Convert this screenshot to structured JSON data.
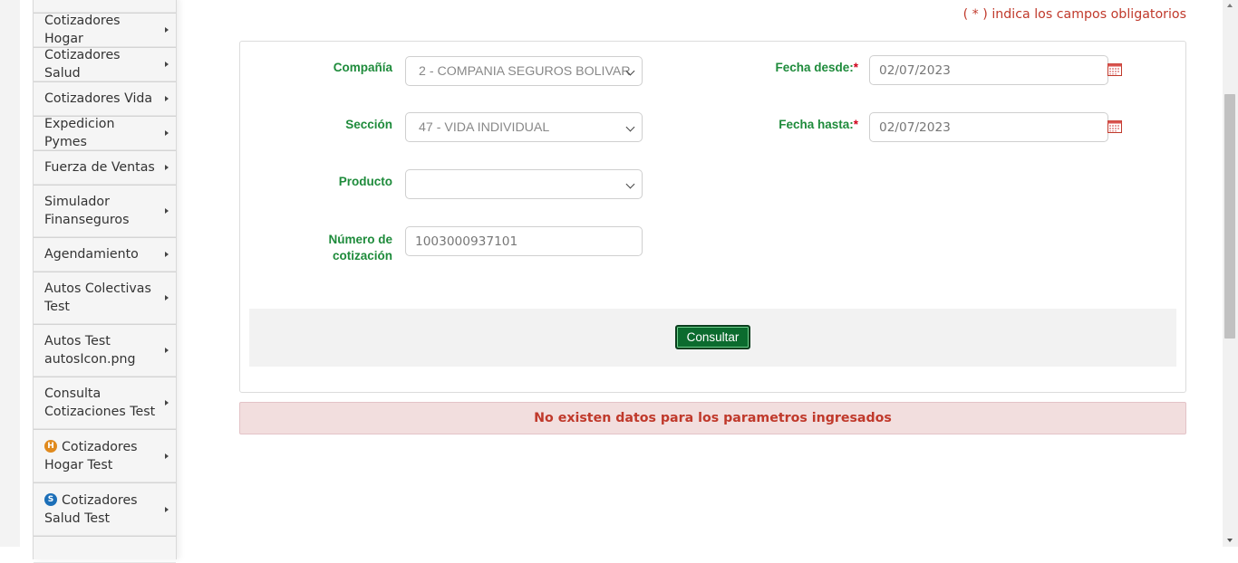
{
  "sidebar": {
    "items": [
      {
        "label": "Cotizadores Hogar",
        "badge": null
      },
      {
        "label": "Cotizadores Salud",
        "badge": null
      },
      {
        "label": "Cotizadores Vida",
        "badge": null
      },
      {
        "label": "Expedicion Pymes",
        "badge": null
      },
      {
        "label": "Fuerza de Ventas",
        "badge": null
      },
      {
        "label": "Simulador Finanseguros",
        "badge": null
      },
      {
        "label": "Agendamiento",
        "badge": null
      },
      {
        "label": "Autos Colectivas Test",
        "badge": null
      },
      {
        "label": "Autos Test autosIcon.png",
        "badge": null
      },
      {
        "label": "Consulta Cotizaciones Test",
        "badge": null
      },
      {
        "label": "Cotizadores Hogar Test",
        "badge": "H"
      },
      {
        "label": "Cotizadores Salud Test",
        "badge": "S"
      }
    ]
  },
  "form": {
    "required_note": "( * ) indica los campos obligatorios",
    "compania_label": "Compañía",
    "compania_value": "2 - COMPANIA SEGUROS BOLIVAR",
    "seccion_label": "Sección",
    "seccion_value": "47 - VIDA INDIVIDUAL",
    "producto_label": "Producto",
    "producto_value": "",
    "numero_label_line1": "Número de",
    "numero_label_line2": "cotización",
    "numero_value": "1003000937101",
    "fecha_desde_label": "Fecha desde:",
    "fecha_desde_value": "02/07/2023",
    "fecha_hasta_label": "Fecha hasta:",
    "fecha_hasta_value": "02/07/2023",
    "required_star": "*",
    "consultar_label": "Consultar"
  },
  "alert": {
    "message": "No existen datos para los parametros ingresados"
  },
  "colors": {
    "label_green": "#1e8b3b",
    "button_green": "#0b6b2e",
    "alert_bg": "#f2dede",
    "alert_text": "#c0392b",
    "badge_hogar": "#e08a1e",
    "badge_salud": "#1c6fb8"
  }
}
